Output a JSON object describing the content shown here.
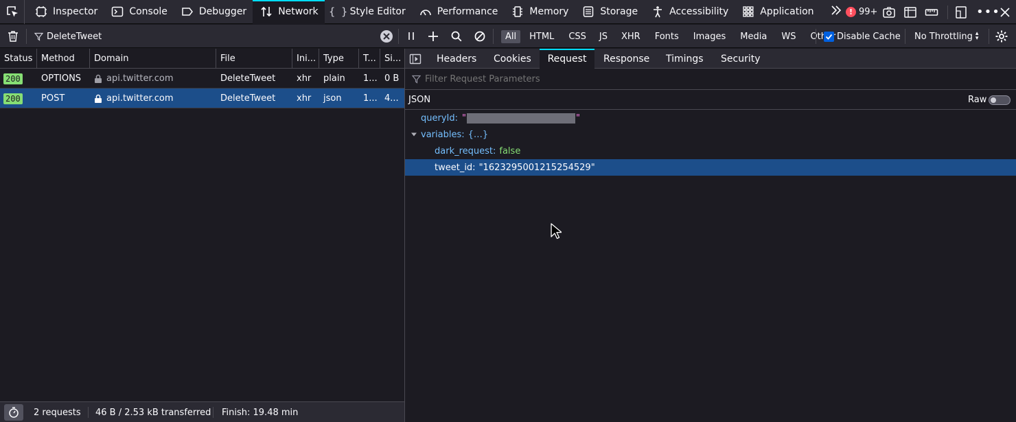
{
  "toolbar": {
    "tabs": [
      {
        "label": "Inspector",
        "icon": "inspector-icon"
      },
      {
        "label": "Console",
        "icon": "console-icon"
      },
      {
        "label": "Debugger",
        "icon": "debugger-icon"
      },
      {
        "label": "Network",
        "icon": "network-icon",
        "active": true
      },
      {
        "label": "Style Editor",
        "icon": "style-editor-icon"
      },
      {
        "label": "Performance",
        "icon": "performance-icon"
      },
      {
        "label": "Memory",
        "icon": "memory-icon"
      },
      {
        "label": "Storage",
        "icon": "storage-icon"
      },
      {
        "label": "Accessibility",
        "icon": "accessibility-icon"
      },
      {
        "label": "Application",
        "icon": "application-icon"
      }
    ],
    "error_count": "99+",
    "error_color": "#ff4f5e"
  },
  "filterbar": {
    "url_filter_value": "DeleteTweet",
    "type_filters": [
      "All",
      "HTML",
      "CSS",
      "JS",
      "XHR",
      "Fonts",
      "Images",
      "Media",
      "WS",
      "Other"
    ],
    "active_type_filter": "All",
    "disable_cache_label": "Disable Cache",
    "disable_cache_checked": true,
    "throttling_label": "No Throttling"
  },
  "requests": {
    "columns": [
      "Status",
      "Method",
      "Domain",
      "File",
      "Ini...",
      "Type",
      "T...",
      "Si..."
    ],
    "rows": [
      {
        "status": "200",
        "method": "OPTIONS",
        "domain": "api.twitter.com",
        "file": "DeleteTweet",
        "initiator": "xhr",
        "type": "plain",
        "transferred": "1...",
        "size": "0 B",
        "selected": false
      },
      {
        "status": "200",
        "method": "POST",
        "domain": "api.twitter.com",
        "file": "DeleteTweet",
        "initiator": "xhr",
        "type": "json",
        "transferred": "1...",
        "size": "4...",
        "selected": true
      }
    ]
  },
  "status_bar": {
    "requests": "2 requests",
    "transferred": "46 B / 2.53 kB transferred",
    "finish": "Finish: 19.48 min"
  },
  "details": {
    "tabs": [
      "Headers",
      "Cookies",
      "Request",
      "Response",
      "Timings",
      "Security"
    ],
    "active_tab": "Request",
    "filter_placeholder": "Filter Request Parameters",
    "section_label": "JSON",
    "raw_label": "Raw",
    "raw_on": false,
    "json": {
      "query_key": "queryId:",
      "variables_key": "variables:",
      "variables_summary": "{…}",
      "dark_request_key": "dark_request:",
      "dark_request_value": "false",
      "tweet_id_key": "tweet_id:",
      "tweet_id_value": "\"1623295001215254529\""
    }
  },
  "colors": {
    "accent": "#00ddff",
    "selection": "#1c4e8a",
    "status_ok": "#86de74",
    "json_key": "#75bfff",
    "json_string": "#ff7de9"
  }
}
